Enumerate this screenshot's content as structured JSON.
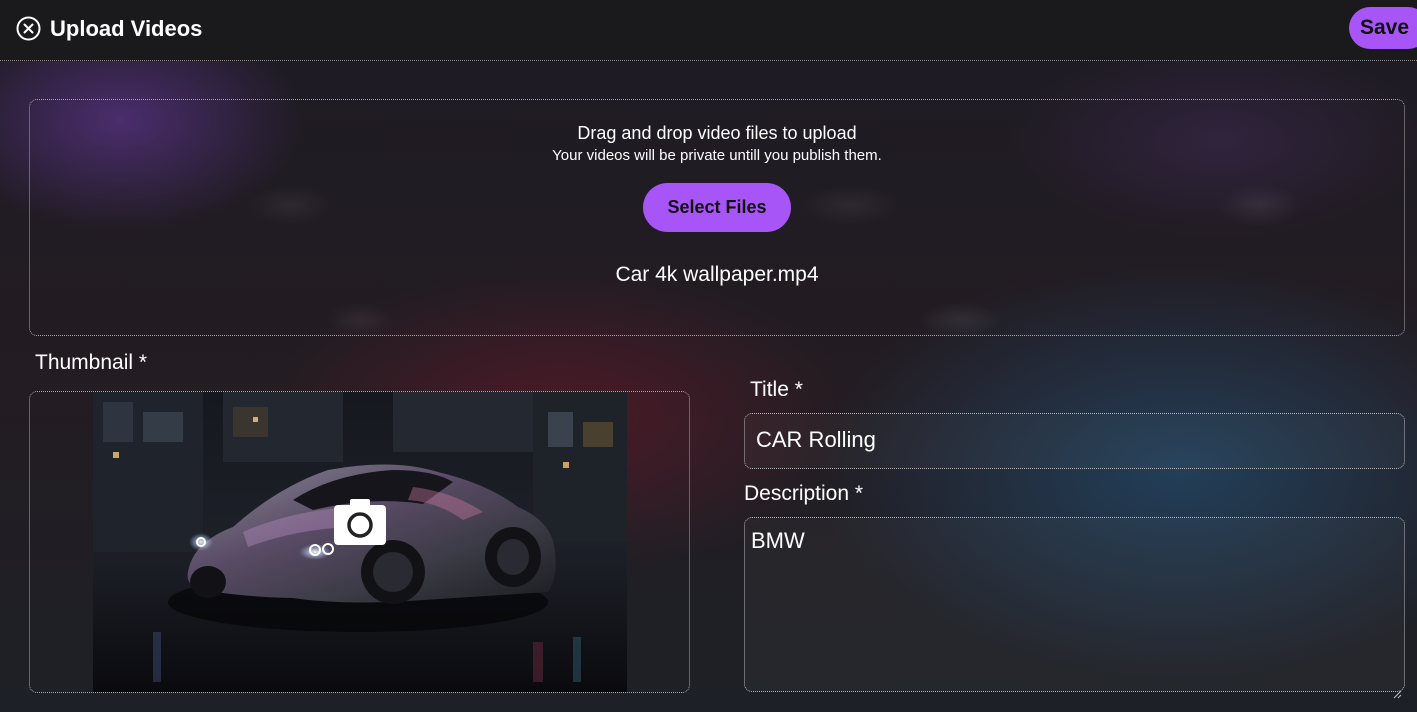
{
  "header": {
    "title": "Upload Videos",
    "save_label": "Save",
    "close_icon": "close-circle-icon"
  },
  "upload": {
    "drag_text": "Drag and drop video files to upload",
    "privacy_text": "Your videos will be private untill you publish them.",
    "select_label": "Select Files",
    "file_name": "Car 4k wallpaper.mp4"
  },
  "thumbnail": {
    "label": "Thumbnail *",
    "camera_icon": "camera-icon"
  },
  "form": {
    "title_label": "Title *",
    "title_value": "CAR Rolling",
    "description_label": "Description *",
    "description_value": "BMW"
  },
  "colors": {
    "accent": "#a855f7",
    "header_bg": "#1a1a1c",
    "text": "#ffffff"
  }
}
